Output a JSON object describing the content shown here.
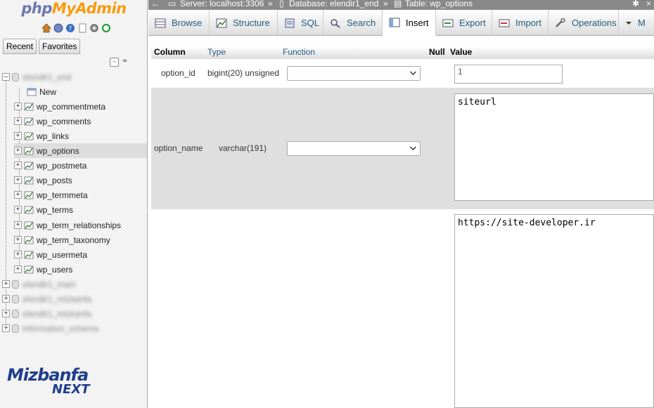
{
  "app": {
    "logo_php": "php",
    "logo_myadmin": "MyAdmin"
  },
  "sidebar": {
    "tabs": [
      "Recent",
      "Favorites"
    ],
    "databases": [
      {
        "name": "elendir1_end",
        "blurred": true,
        "expanded": true
      },
      {
        "name": "elendir1_main",
        "blurred": true
      },
      {
        "name": "elendir1_mizbanfa",
        "blurred": true
      },
      {
        "name": "elendir1_mizbanfa",
        "blurred": true
      },
      {
        "name": "information_schema",
        "blurred": true
      }
    ],
    "new_label": "New",
    "tables": [
      "wp_commentmeta",
      "wp_comments",
      "wp_links",
      "wp_options",
      "wp_postmeta",
      "wp_posts",
      "wp_termmeta",
      "wp_terms",
      "wp_term_relationships",
      "wp_term_taxonomy",
      "wp_usermeta",
      "wp_users"
    ],
    "selected_table": "wp_options",
    "brand_top": "Mizbanfa",
    "brand_bottom": "NEXT"
  },
  "breadcrumb": {
    "server": "Server: localhost:3306",
    "database": "Database: elendir1_end",
    "table": "Table: wp_options",
    "separator": "»"
  },
  "tabs": [
    {
      "label": "Browse",
      "icon": "browse-icon"
    },
    {
      "label": "Structure",
      "icon": "structure-icon"
    },
    {
      "label": "SQL",
      "icon": "sql-icon"
    },
    {
      "label": "Search",
      "icon": "search-icon"
    },
    {
      "label": "Insert",
      "icon": "insert-icon",
      "active": true
    },
    {
      "label": "Export",
      "icon": "export-icon"
    },
    {
      "label": "Import",
      "icon": "import-icon"
    },
    {
      "label": "Operations",
      "icon": "operations-icon"
    },
    {
      "label": "M",
      "icon": "more-icon"
    }
  ],
  "insert_table": {
    "headers": {
      "column": "Column",
      "type": "Type",
      "function": "Function",
      "null": "Null",
      "value": "Value"
    },
    "rows": [
      {
        "column": "option_id",
        "type": "bigint(20) unsigned",
        "function": "",
        "value": "1"
      },
      {
        "column": "option_name",
        "type": "varchar(191)",
        "function": "",
        "value": "siteurl"
      },
      {
        "column": "",
        "type": "",
        "function": "",
        "value": "https://site-developer.ir"
      }
    ]
  },
  "colors": {
    "logo_php": "#6c78af",
    "logo_myadmin": "#f89c0e",
    "link": "#235a81",
    "crumb_bar": "#888888",
    "odd_row": "#dfdfdf"
  }
}
